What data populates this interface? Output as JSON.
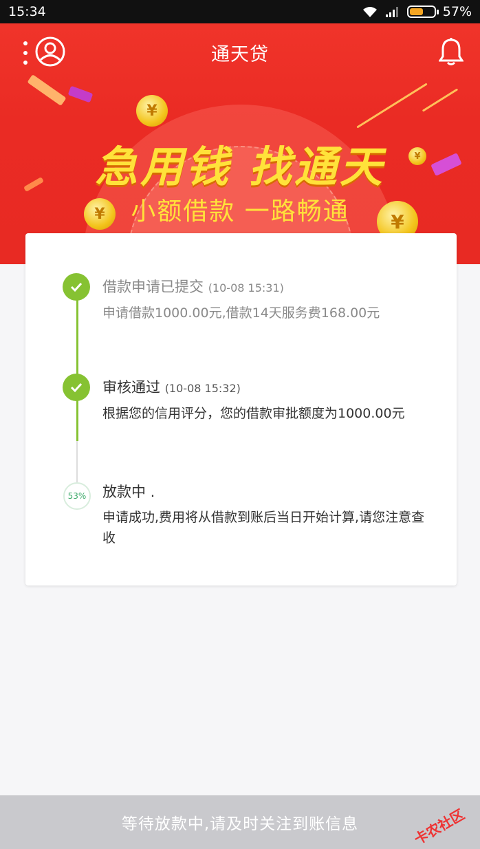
{
  "status_bar": {
    "time": "15:34",
    "battery_percent": "57%",
    "battery_level": 0.57
  },
  "header": {
    "title": "通天贷"
  },
  "banner": {
    "slogan_main": "急用钱 找通天",
    "slogan_sub": "小额借款 一路畅通",
    "coin_symbol": "¥"
  },
  "timeline": {
    "steps": [
      {
        "title": "借款申请已提交",
        "time": "(10-08 15:31)",
        "desc": "申请借款1000.00元,借款14天服务费168.00元",
        "status": "done"
      },
      {
        "title": "审核通过",
        "time": "(10-08 15:32)",
        "desc": "根据您的信用评分，您的借款审批额度为1000.00元",
        "status": "done"
      },
      {
        "title": "放款中 .",
        "progress": "53%",
        "desc": "申请成功,费用将从借款到账后当日开始计算,请您注意查收",
        "status": "in_progress"
      }
    ]
  },
  "bottom_bar": {
    "text": "等待放款中,请及时关注到账信息"
  },
  "watermark": {
    "text": "卡农社区"
  },
  "colors": {
    "brand_red": "#ea2b24",
    "step_green": "#86c232",
    "slogan_yellow": "#ffe23a"
  }
}
